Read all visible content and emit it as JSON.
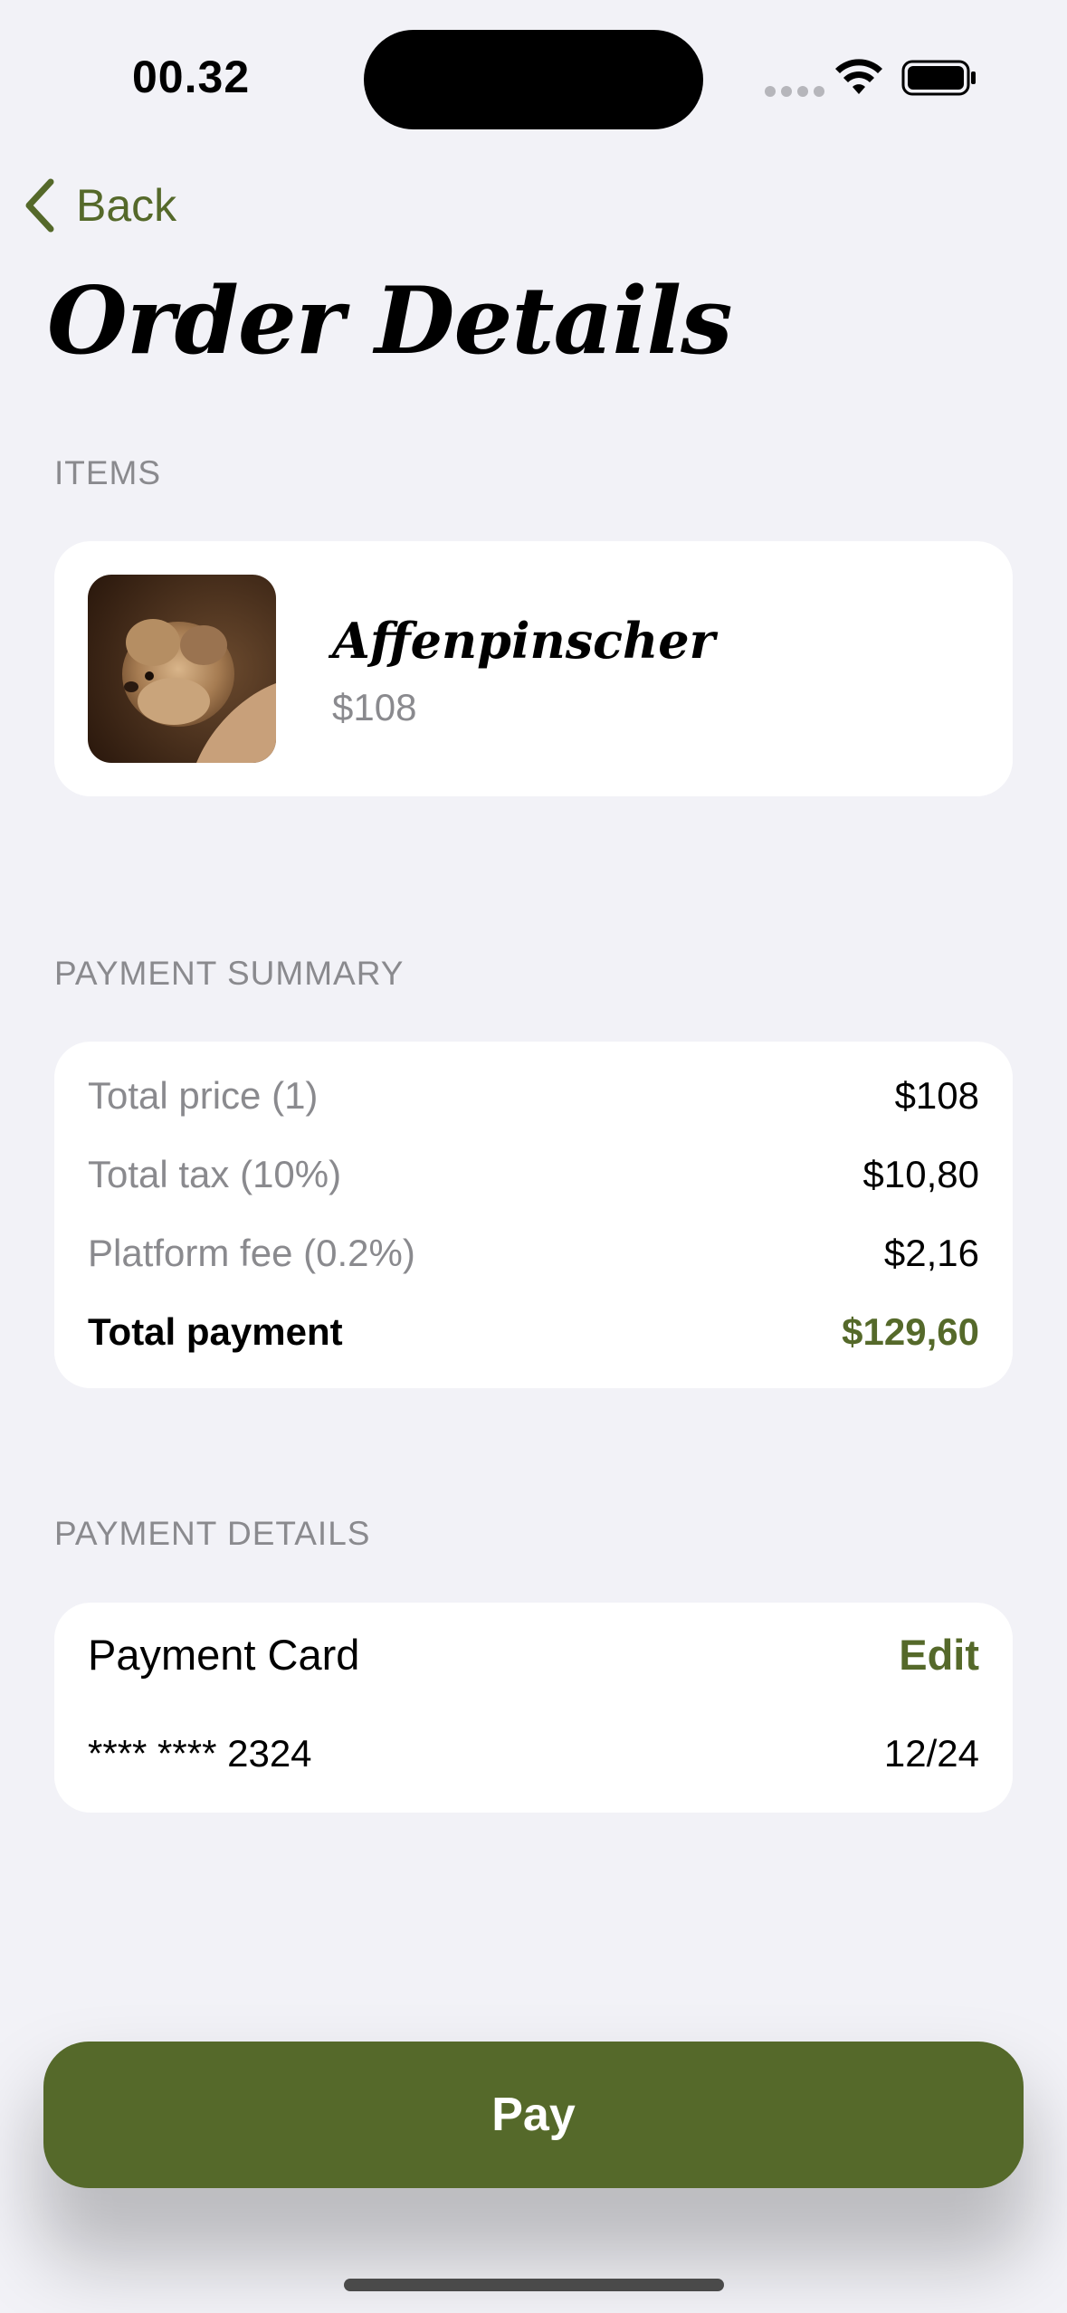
{
  "status_bar": {
    "time": "00.32"
  },
  "nav": {
    "back_label": "Back"
  },
  "page": {
    "title": "Order Details"
  },
  "items_section": {
    "label": "ITEMS",
    "items": [
      {
        "name": "Affenpinscher",
        "price": "$108",
        "image": "dog-photo"
      }
    ]
  },
  "summary_section": {
    "label": "PAYMENT SUMMARY",
    "rows": [
      {
        "label": "Total price (1)",
        "value": "$108"
      },
      {
        "label": "Total tax (10%)",
        "value": "$10,80"
      },
      {
        "label": "Platform fee (0.2%)",
        "value": "$2,16"
      }
    ],
    "total": {
      "label": "Total payment",
      "value": "$129,60"
    }
  },
  "payment_section": {
    "label": "PAYMENT DETAILS",
    "card_title": "Payment Card",
    "edit_label": "Edit",
    "card_number": "**** **** 2324",
    "card_expiry": "12/24"
  },
  "actions": {
    "pay_label": "Pay"
  },
  "colors": {
    "accent": "#55692a",
    "background": "#f2f2f7",
    "secondary_text": "#8a8a8e"
  }
}
